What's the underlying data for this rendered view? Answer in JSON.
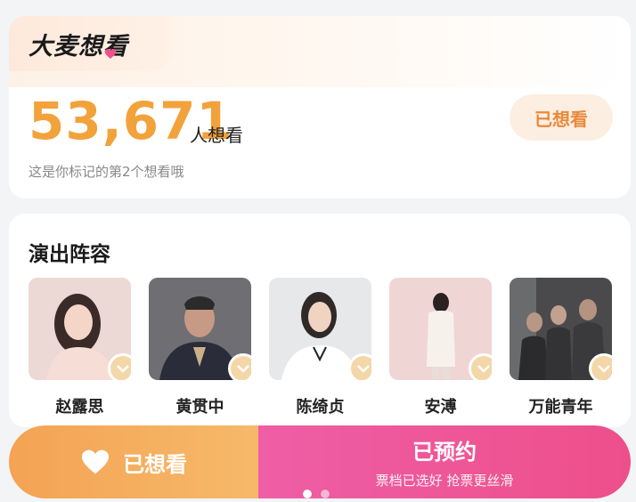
{
  "want_card": {
    "brand": "大麦想看",
    "count": "53,671",
    "count_suffix": "人想看",
    "note": "这是你标记的第2个想看哦",
    "status_button": "已想看"
  },
  "cast": {
    "title": "演出阵容",
    "members": [
      {
        "name": "赵露思"
      },
      {
        "name": "黄贯中"
      },
      {
        "name": "陈绮贞"
      },
      {
        "name": "安溥"
      },
      {
        "name": "万能青年"
      }
    ]
  },
  "action_bar": {
    "want_label": "已想看",
    "reserve_label": "已预约",
    "reserve_sub": "票档已选好 抢票更丝滑"
  },
  "pager": {
    "count": 2,
    "active_index": 0
  },
  "colors": {
    "accent_orange": "#f2a23b",
    "accent_pink": "#ed4f8a",
    "badge": "#f3d7a8"
  }
}
